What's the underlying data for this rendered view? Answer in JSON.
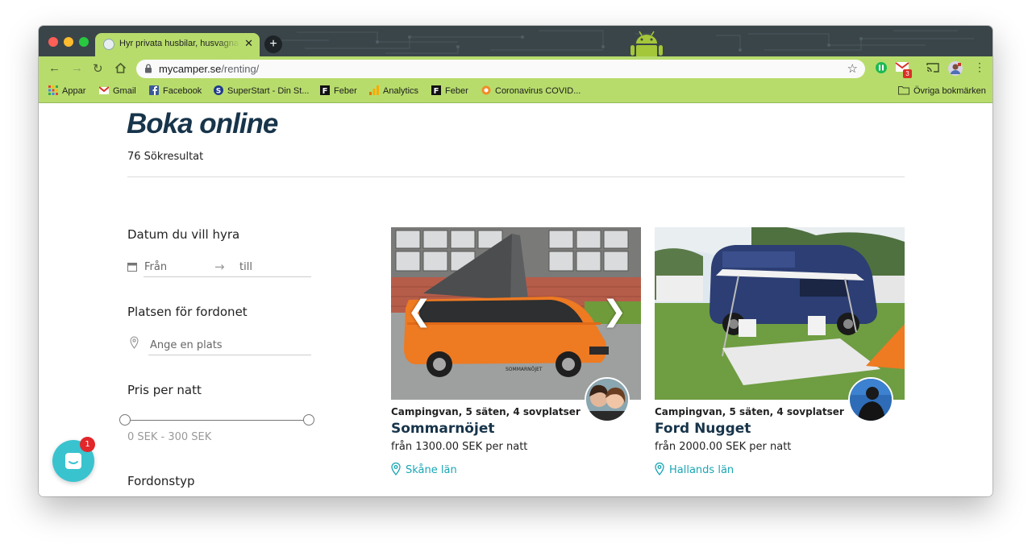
{
  "browser": {
    "tab_title": "Hyr privata husbilar, husvagnar och",
    "url_host": "mycamper.se",
    "url_path": "/renting/",
    "new_tab_label": "+",
    "gmail_badge": "3",
    "bookmarks": [
      {
        "label": "Appar",
        "icon": "apps-grid-icon"
      },
      {
        "label": "Gmail",
        "icon": "gmail-icon"
      },
      {
        "label": "Facebook",
        "icon": "facebook-icon"
      },
      {
        "label": "SuperStart - Din St...",
        "icon": "superstart-icon"
      },
      {
        "label": "Feber",
        "icon": "feber-icon"
      },
      {
        "label": "Analytics",
        "icon": "analytics-icon"
      },
      {
        "label": "Feber",
        "icon": "feber-icon"
      },
      {
        "label": "Coronavirus COVID...",
        "icon": "covid-icon"
      }
    ],
    "other_bookmarks": "Övriga bokmärken"
  },
  "page": {
    "heading": "Boka online",
    "result_count": "76 Sökresultat"
  },
  "filters": {
    "date_label": "Datum du vill hyra",
    "date_from_placeholder": "Från",
    "date_arrow": "→",
    "date_to_placeholder": "till",
    "place_label": "Platsen för fordonet",
    "place_placeholder": "Ange en plats",
    "price_label": "Pris per natt",
    "price_range": "0 SEK - 300 SEK",
    "vehicle_type_label": "Fordonstyp"
  },
  "listings": [
    {
      "type": "Campingvan, 5 säten, 4 sovplatser",
      "name": "Sommarnöjet",
      "price": "från 1300.00 SEK per natt",
      "location": "Skåne län",
      "prev_label": "❮",
      "next_label": "❯"
    },
    {
      "type": "Campingvan, 5 säten, 4 sovplatser",
      "name": "Ford Nugget",
      "price": "från 2000.00 SEK per natt",
      "location": "Hallands län"
    }
  ],
  "chat": {
    "badge": "1"
  },
  "colors": {
    "chrome_green": "#b7dc6c",
    "titlebar": "#3a4549",
    "heading": "#17344a",
    "accent_teal": "#1aa6b5",
    "chat": "#39c3cf"
  }
}
